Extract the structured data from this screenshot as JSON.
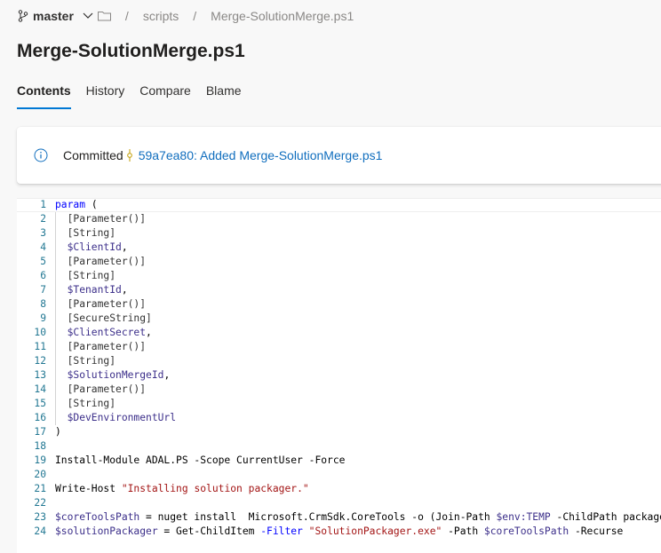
{
  "header": {
    "branch": "master",
    "breadcrumb": [
      "scripts",
      "Merge-SolutionMerge.ps1"
    ],
    "separator": "/",
    "title": "Merge-SolutionMerge.ps1"
  },
  "tabs": [
    {
      "label": "Contents",
      "active": true
    },
    {
      "label": "History"
    },
    {
      "label": "Compare"
    },
    {
      "label": "Blame"
    }
  ],
  "commit": {
    "prefix": "Committed",
    "link": "59a7ea80: Added Merge-SolutionMerge.ps1"
  },
  "colors": {
    "accent": "#0078d4",
    "link": "#106ebe",
    "keyword": "#0000ff",
    "string": "#a31515",
    "variable": "#3c2f8a"
  },
  "code": [
    [
      [
        "kw",
        "param"
      ],
      [
        "pun",
        " ("
      ]
    ],
    [
      [
        "typ",
        "  [Parameter()]"
      ]
    ],
    [
      [
        "typ",
        "  [String]"
      ]
    ],
    [
      [
        "var",
        "  $ClientId"
      ],
      [
        "pun",
        ","
      ]
    ],
    [
      [
        "typ",
        "  [Parameter()]"
      ]
    ],
    [
      [
        "typ",
        "  [String]"
      ]
    ],
    [
      [
        "var",
        "  $TenantId"
      ],
      [
        "pun",
        ","
      ]
    ],
    [
      [
        "typ",
        "  [Parameter()]"
      ]
    ],
    [
      [
        "typ",
        "  [SecureString]"
      ]
    ],
    [
      [
        "var",
        "  $ClientSecret"
      ],
      [
        "pun",
        ","
      ]
    ],
    [
      [
        "typ",
        "  [Parameter()]"
      ]
    ],
    [
      [
        "typ",
        "  [String]"
      ]
    ],
    [
      [
        "var",
        "  $SolutionMergeId"
      ],
      [
        "pun",
        ","
      ]
    ],
    [
      [
        "typ",
        "  [Parameter()]"
      ]
    ],
    [
      [
        "typ",
        "  [String]"
      ]
    ],
    [
      [
        "var",
        "  $DevEnvironmentUrl"
      ]
    ],
    [
      [
        "pun",
        ")"
      ]
    ],
    [],
    [
      [
        "pun",
        "Install-Module ADAL.PS -Scope CurrentUser -Force"
      ]
    ],
    [],
    [
      [
        "pun",
        "Write-Host "
      ],
      [
        "str",
        "\"Installing solution packager.\""
      ]
    ],
    [],
    [
      [
        "var",
        "$coreToolsPath"
      ],
      [
        "pun",
        " = nuget install  Microsoft.CrmSdk.CoreTools -o (Join-Path "
      ],
      [
        "var",
        "$env:TEMP"
      ],
      [
        "pun",
        " -ChildPath packages)"
      ]
    ],
    [
      [
        "var",
        "$solutionPackager"
      ],
      [
        "pun",
        " = Get-ChildItem "
      ],
      [
        "kw",
        "-Filter"
      ],
      [
        "pun",
        " "
      ],
      [
        "str",
        "\"SolutionPackager.exe\""
      ],
      [
        "pun",
        " -Path "
      ],
      [
        "var",
        "$coreToolsPath"
      ],
      [
        "pun",
        " -Recurse"
      ]
    ]
  ]
}
